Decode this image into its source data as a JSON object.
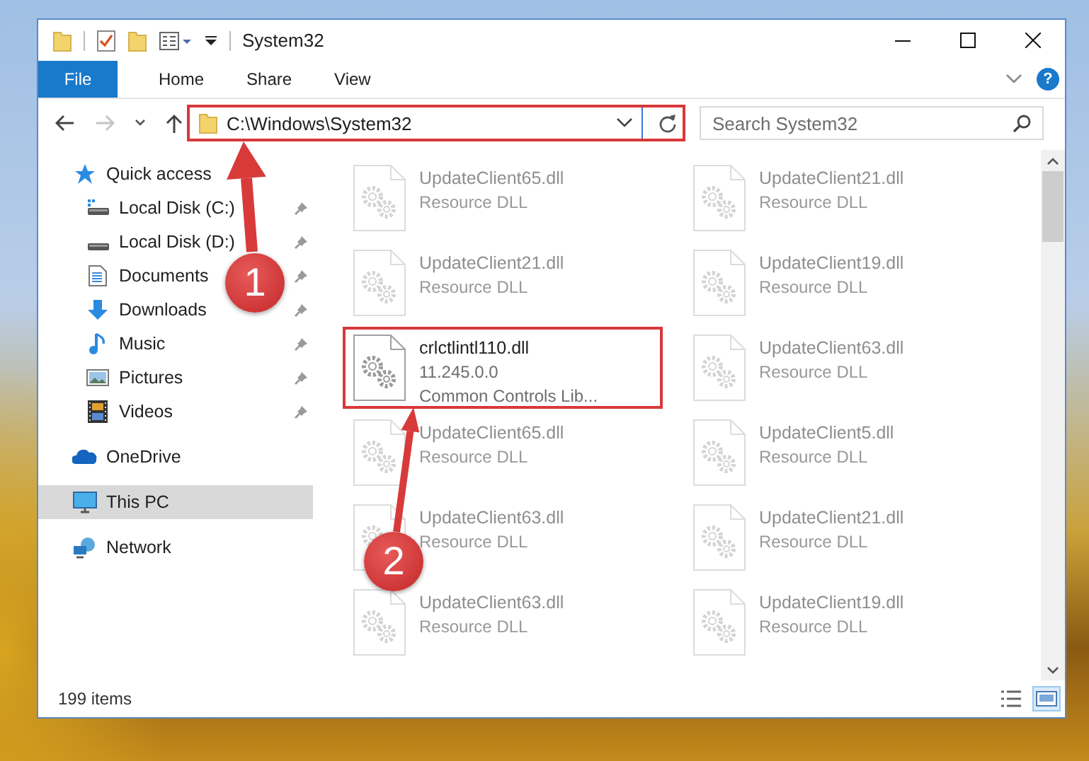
{
  "window": {
    "title": "System32"
  },
  "ribbon": {
    "tabs": [
      {
        "label": "File",
        "kind": "file",
        "selected": false
      },
      {
        "label": "Home",
        "kind": "tab",
        "selected": false
      },
      {
        "label": "Share",
        "kind": "tab",
        "selected": false
      },
      {
        "label": "View",
        "kind": "tab",
        "selected": false
      }
    ],
    "help": "?"
  },
  "navigation": {
    "forward_enabled": false
  },
  "address": {
    "path": "C:\\Windows\\System32",
    "highlighted": true
  },
  "search": {
    "placeholder": "Search System32"
  },
  "sidebar": {
    "items": [
      {
        "label": "Quick access",
        "kind": "star",
        "selected": false,
        "children": [
          {
            "label": "Local Disk (C:)",
            "kind": "drive-c",
            "pinned": true
          },
          {
            "label": "Local Disk (D:)",
            "kind": "drive",
            "pinned": true
          },
          {
            "label": "Documents",
            "kind": "documents",
            "pinned": true
          },
          {
            "label": "Downloads",
            "kind": "downloads",
            "pinned": true
          },
          {
            "label": "Music",
            "kind": "music",
            "pinned": true
          },
          {
            "label": "Pictures",
            "kind": "pictures",
            "pinned": true
          },
          {
            "label": "Videos",
            "kind": "videos",
            "pinned": true
          }
        ]
      },
      {
        "label": "OneDrive",
        "kind": "cloud",
        "selected": false
      },
      {
        "label": "This PC",
        "kind": "pc",
        "selected": true
      },
      {
        "label": "Network",
        "kind": "network",
        "selected": false
      }
    ]
  },
  "files": [
    {
      "name": "UpdateClient65.dll",
      "lines": [
        "Resource DLL"
      ],
      "dimmed": true,
      "highlighted": false
    },
    {
      "name": "UpdateClient21.dll",
      "lines": [
        "Resource DLL"
      ],
      "dimmed": true,
      "highlighted": false
    },
    {
      "name": "UpdateClient21.dll",
      "lines": [
        "Resource DLL"
      ],
      "dimmed": true,
      "highlighted": false
    },
    {
      "name": "UpdateClient19.dll",
      "lines": [
        "Resource DLL"
      ],
      "dimmed": true,
      "highlighted": false
    },
    {
      "name": "crlctlintl110.dll",
      "lines": [
        "11.245.0.0",
        "Common Controls Lib..."
      ],
      "dimmed": false,
      "highlighted": true
    },
    {
      "name": "UpdateClient63.dll",
      "lines": [
        "Resource DLL"
      ],
      "dimmed": true,
      "highlighted": false
    },
    {
      "name": "UpdateClient65.dll",
      "lines": [
        "Resource DLL"
      ],
      "dimmed": true,
      "highlighted": false
    },
    {
      "name": "UpdateClient5.dll",
      "lines": [
        "Resource DLL"
      ],
      "dimmed": true,
      "highlighted": false
    },
    {
      "name": "UpdateClient63.dll",
      "lines": [
        "Resource DLL"
      ],
      "dimmed": true,
      "highlighted": false
    },
    {
      "name": "UpdateClient21.dll",
      "lines": [
        "Resource DLL"
      ],
      "dimmed": true,
      "highlighted": false
    },
    {
      "name": "UpdateClient63.dll",
      "lines": [
        "Resource DLL"
      ],
      "dimmed": true,
      "highlighted": false
    },
    {
      "name": "UpdateClient19.dll",
      "lines": [
        "Resource DLL"
      ],
      "dimmed": true,
      "highlighted": false
    }
  ],
  "status_bar": {
    "count": "199 items"
  },
  "annotations": [
    {
      "number": "1"
    },
    {
      "number": "2"
    }
  ]
}
